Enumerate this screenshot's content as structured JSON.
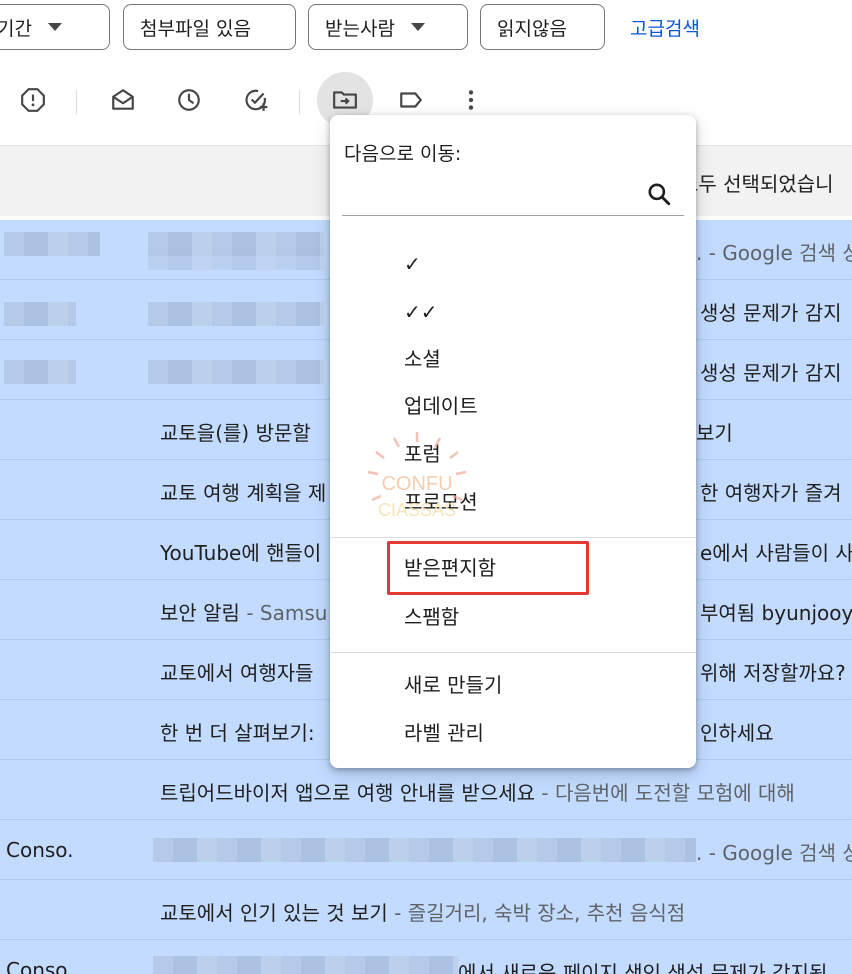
{
  "filters": {
    "period": "기간",
    "attachment": "첨부파일 있음",
    "recipient": "받는사람",
    "unread": "읽지않음",
    "advanced": "고급검색"
  },
  "banner": {
    "text": "모두 선택되었습니"
  },
  "move_menu": {
    "heading": "다음으로 이동:",
    "search_placeholder": "",
    "items": [
      "✓",
      "✓✓",
      "소셜",
      "업데이트",
      "포럼",
      "프로모션"
    ],
    "inbox": "받은편지함",
    "spam": "스팸함",
    "create_new": "새로 만들기",
    "manage_labels": "라벨 관리"
  },
  "watermark": {
    "line1": "CONFU",
    "line2": "CIASSAS"
  },
  "emails": [
    {
      "sender": "",
      "subject": "",
      "snippet": ". - Google 검색 상"
    },
    {
      "sender": "",
      "subject": "",
      "snippet": "생성 문제가 감지"
    },
    {
      "sender": "",
      "subject": "",
      "snippet": "생성 문제가 감지"
    },
    {
      "sender": "",
      "subject": "교토을(를) 방문할",
      "snippet": "보기"
    },
    {
      "sender": "",
      "subject": "교토 여행 계획을 제",
      "snippet": "한 여행자가 즐겨"
    },
    {
      "sender": "",
      "subject": "YouTube에 핸들이",
      "snippet": "e에서 사람들이 사"
    },
    {
      "sender": "",
      "subject": "보안 알림",
      "subject_snippet": " - Samsu",
      "snippet": "부여됨 byunjooy"
    },
    {
      "sender": "",
      "subject": "교토에서 여행자들",
      "snippet": "위해 저장할까요?"
    },
    {
      "sender": "",
      "subject": "한 번 더 살펴보기:",
      "snippet": "인하세요"
    },
    {
      "sender": "",
      "subject": "트립어드바이저 앱으로 여행 안내를 받으세요",
      "subject_snippet": " - 다음번에 도전할 모험에 대해",
      "snippet": ""
    },
    {
      "sender": "Conso.",
      "subject": "",
      "snippet": ". - Google 검색 상"
    },
    {
      "sender": "",
      "subject": "교토에서 인기 있는 것 보기",
      "subject_snippet": " - 즐길거리, 숙박 장소, 추천 음식점",
      "snippet": ""
    },
    {
      "sender": "Conso.",
      "subject": "",
      "snippet": "에서 새로운 페이지 색인 생성 문제가 감지됨"
    }
  ],
  "colors": {
    "selected_row": "#c2dbff",
    "link": "#0b57d0",
    "highlight_box": "#e53935"
  },
  "icons": [
    "report-spam-icon",
    "mark-unread-icon",
    "snooze-icon",
    "add-task-icon",
    "move-to-icon",
    "label-icon",
    "more-vert-icon",
    "search-icon"
  ]
}
